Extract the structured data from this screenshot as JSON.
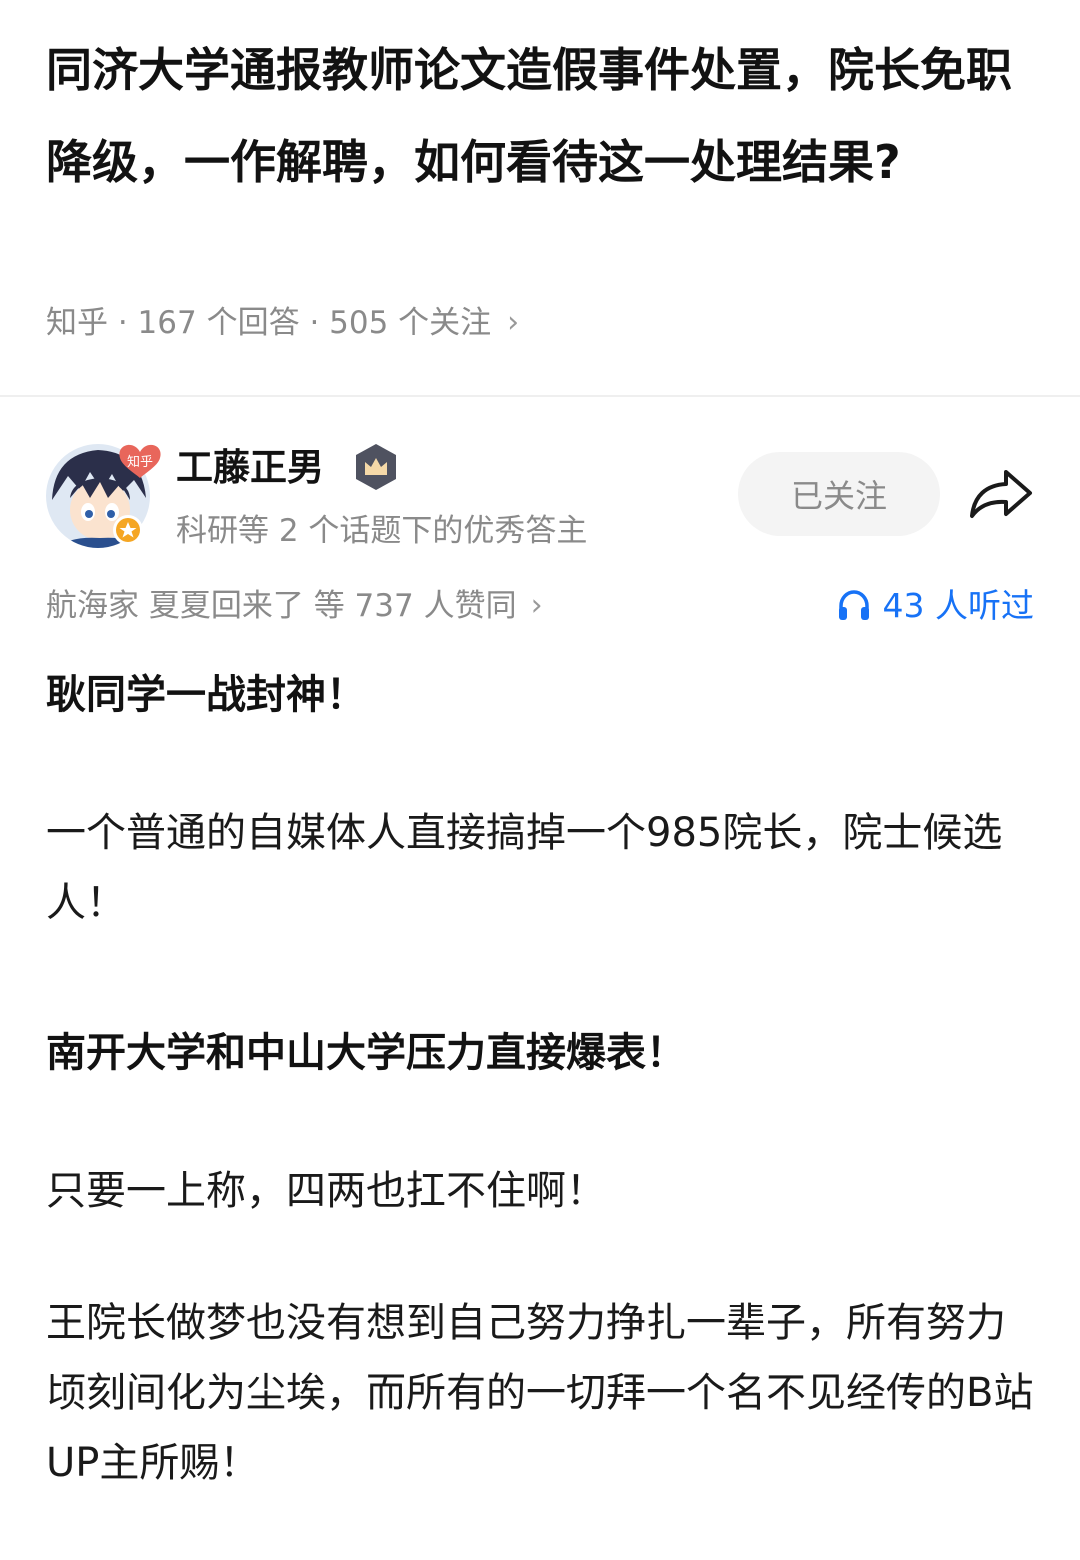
{
  "question": {
    "title": "同济大学通报教师论文造假事件处置，院长免职降级，一作解聘，如何看待这一处理结果?",
    "meta": "知乎 · 167 个回答 · 505 个关注"
  },
  "author": {
    "name": "工藤正男",
    "description": "科研等 2 个话题下的优秀答主",
    "avatar_tag": "知乎",
    "follow_label": "已关注",
    "share_icon": "share-arrow-icon"
  },
  "engagement": {
    "voters": "航海家 夏夏回来了 等 737 人赞同",
    "listened": "43 人听过",
    "accent_color": "#1772f6"
  },
  "content": {
    "paragraphs": [
      "耿同学一战封神！",
      "一个普通的自媒体人直接搞掉一个985院长，院士候选人！",
      "南开大学和中山大学压力直接爆表！",
      "只要一上称，四两也扛不住啊！",
      "王院长做梦也没有想到自己努力挣扎一辈子，所有努力顷刻间化为尘埃，而所有的一切拜一个名不见经传的B站UP主所赐！"
    ]
  }
}
